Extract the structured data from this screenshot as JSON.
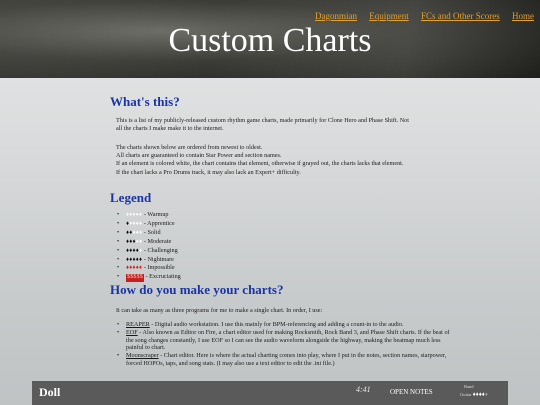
{
  "nav": {
    "links": [
      "Dagonmian",
      "Equipment",
      "FCs and Other Scores",
      "Home"
    ]
  },
  "site_title": "Custom Charts",
  "whats_this": {
    "heading": "What's this?",
    "para1_line1": "This is a list of my publicly-released custom rhythm game charts, made primarily for Clone Hero and Phase Shift. Not",
    "para1_line2": "all the charts I make make it to the internet.",
    "para2_line1": "The charts shown below are ordered from newest to oldest.",
    "para2_line2": "All charts are guaranteed to contain Star Power and section names.",
    "para2_line3": "If an element is colored white, the chart contains that element, otherwise if grayed out, the charts lacks that element.",
    "para2_line4": "If the chart lacks a Pro Drums track, it may also lack an Expert+ difficulty."
  },
  "legend": {
    "heading": "Legend",
    "items": [
      {
        "diamonds": "♦♦♦♦♦",
        "style": "white",
        "label": " - Warmup"
      },
      {
        "diamonds": "♦",
        "style": "black",
        "label": " - Apprentice"
      },
      {
        "diamonds": "♦♦",
        "style": "black",
        "label": " - Solid"
      },
      {
        "diamonds": "♦♦♦",
        "style": "black",
        "label": " - Moderate"
      },
      {
        "diamonds": "♦♦♦♦",
        "style": "black",
        "label": " - Challenging"
      },
      {
        "diamonds": "♦♦♦♦♦",
        "style": "black",
        "label": " - Nightmare"
      },
      {
        "diamonds": "♦♦♦♦♦",
        "style": "red",
        "label": " - Impossible"
      },
      {
        "diamonds": "$$$$$",
        "style": "exc",
        "label": " - Excruciating"
      }
    ]
  },
  "how": {
    "heading": "How do you make your charts?",
    "intro": "It can take as many as three programs for me to make a single chart. In order, I use:",
    "tools": [
      {
        "name": "REAPER",
        "text": " - Digital audio workstation. I use this mainly for BPM-referencing and adding a count-in to the audio."
      },
      {
        "name": "EOF",
        "text": " - Also known as Editor on Fire, a chart editor used for making Rocksmith, Rock Band 3, and Phase Shift charts. If the beat of the song changes constantly, I use EOF so I can see the audio waveform alongside the highway, making the beatmap much less painful to chart."
      },
      {
        "name": "Moonscraper",
        "text": " - Chart editor. Here is where the actual charting comes into play, where I put in the notes, section names, starpower, forced HOPOs, taps, and song stats. (I may also use a text editor to edit the .ini file.)"
      }
    ]
  },
  "chart_entry": {
    "name": "Doll",
    "length": "4:41",
    "open_notes": "OPEN NOTES",
    "band_label": "Band",
    "guitar_label": "Guitar",
    "guitar_diamonds": "♦♦♦♦"
  }
}
